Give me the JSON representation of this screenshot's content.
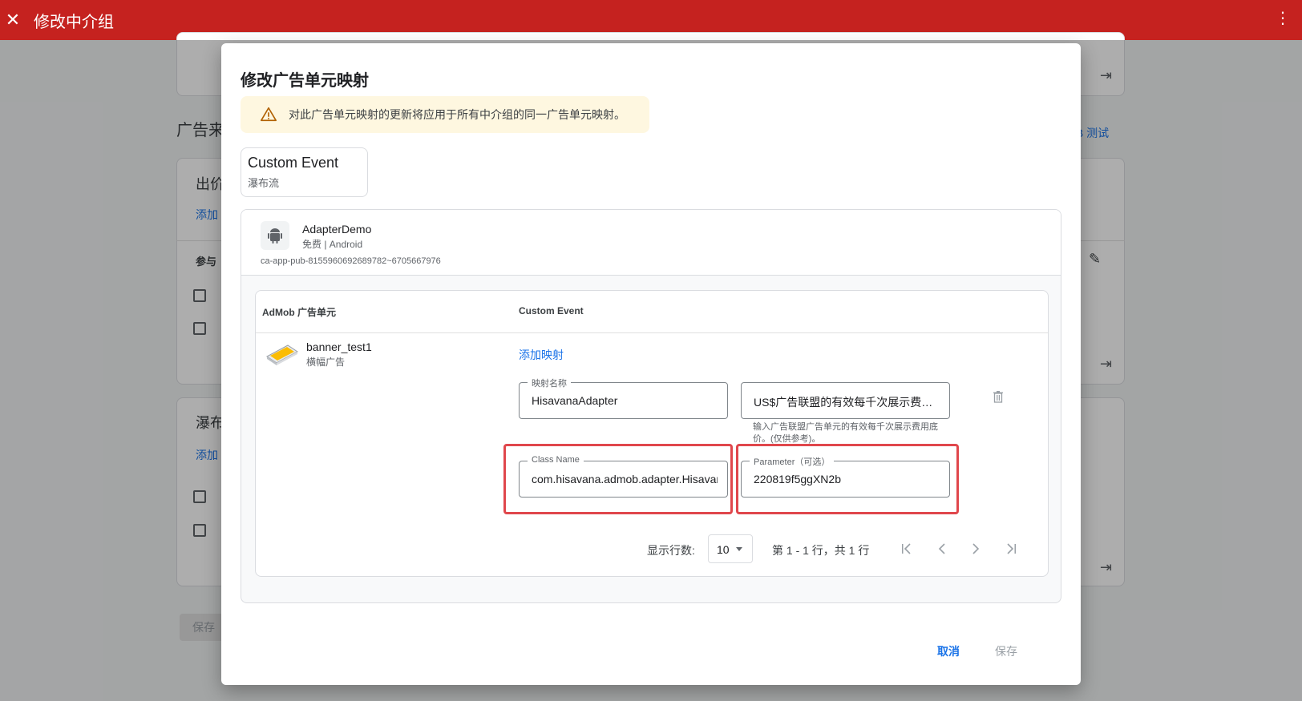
{
  "topbar": {
    "title": "修改中介组"
  },
  "background": {
    "section_ad_source": "广告来",
    "section_bidding": "出价",
    "section_waterfall": "瀑布",
    "add_link_1": "添加",
    "add_link_2": "添加",
    "participate": "参与",
    "ab_test": "/B 测试",
    "save": "保存"
  },
  "dialog": {
    "title": "修改广告单元映射",
    "warning": "对此广告单元映射的更新将应用于所有中介组的同一广告单元映射。",
    "source_chip": {
      "name": "Custom Event",
      "sub": "瀑布流"
    },
    "app": {
      "name": "AdapterDemo",
      "sub": "免费 | Android",
      "id": "ca-app-pub-8155960692689782~6705667976"
    },
    "table": {
      "col_admob": "AdMob 广告单元",
      "col_custom": "Custom Event",
      "unit_name": "banner_test1",
      "unit_type": "横幅广告",
      "add_mapping": "添加映射",
      "mapping_name_label": "映射名称",
      "mapping_name_value": "HisavanaAdapter",
      "ecpm_value": "US$广告联盟的有效每千次展示费用...",
      "ecpm_hint": "输入广告联盟广告单元的有效每千次展示费用底价。(仅供参考)。",
      "class_name_label": "Class Name",
      "class_name_value": "com.hisavana.admob.adapter.Hisavan",
      "parameter_label": "Parameter（可选）",
      "parameter_value": "220819f5ggXN2b"
    },
    "pager": {
      "rows_label": "显示行数:",
      "rows_value": "10",
      "range": "第 1 - 1 行，共 1 行"
    },
    "cancel": "取消",
    "save": "保存"
  }
}
